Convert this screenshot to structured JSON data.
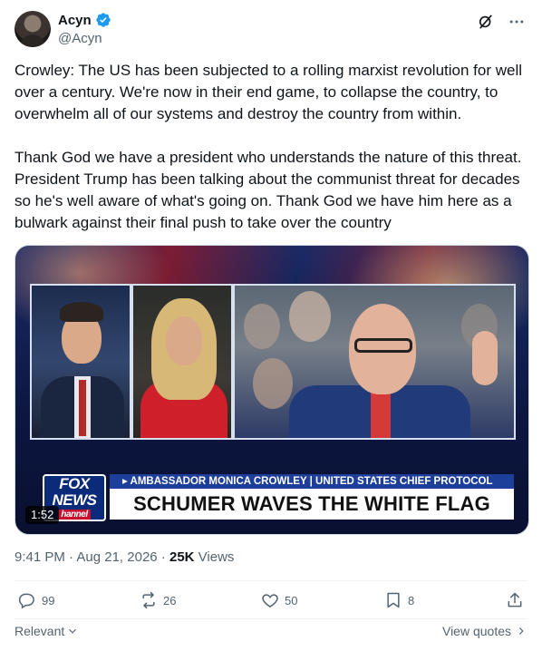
{
  "author": {
    "display_name": "Acyn",
    "handle": "@Acyn",
    "verified": true,
    "verified_color": "#1d9bf0"
  },
  "tweet": {
    "text": "Crowley: The US has been subjected to a rolling marxist revolution for well over a century. We're now in their end game, to collapse the country, to overwhelm all of our systems and destroy the country from within.\n\nThank God we have a president who understands the nature of this threat. President Trump has been talking about the communist threat for decades so he's well aware of what's going on. Thank God we have him here as a bulwark against their final push to take over the country"
  },
  "video": {
    "duration": "1:52",
    "logo_line1": "FOX",
    "logo_line2": "NEWS",
    "logo_line3": "hannel",
    "banner_top": "▸ AMBASSADOR MONICA CROWLEY | UNITED STATES CHIEF PROTOCOL",
    "banner_main": "SCHUMER WAVES THE WHITE FLAG"
  },
  "meta": {
    "time": "9:41 PM",
    "sep1": " · ",
    "date": "Aug 21, 2026",
    "sep2": " · ",
    "views_count": "25K",
    "views_label": " Views"
  },
  "actions": {
    "replies": "99",
    "reposts": "26",
    "likes": "50",
    "bookmarks": "8"
  },
  "footer": {
    "sort_label": "Relevant",
    "view_quotes_label": "View quotes"
  },
  "icons": {
    "more": "more-icon",
    "grok": "grok-icon",
    "reply": "reply-icon",
    "repost": "repost-icon",
    "like": "heart-icon",
    "bookmark": "bookmark-icon",
    "share": "share-icon"
  },
  "colors": {
    "text": "#0f1419",
    "secondary": "#536471",
    "accent": "#1d9bf0",
    "fox_red": "#c8102e",
    "fox_blue": "#1d3f9a"
  }
}
